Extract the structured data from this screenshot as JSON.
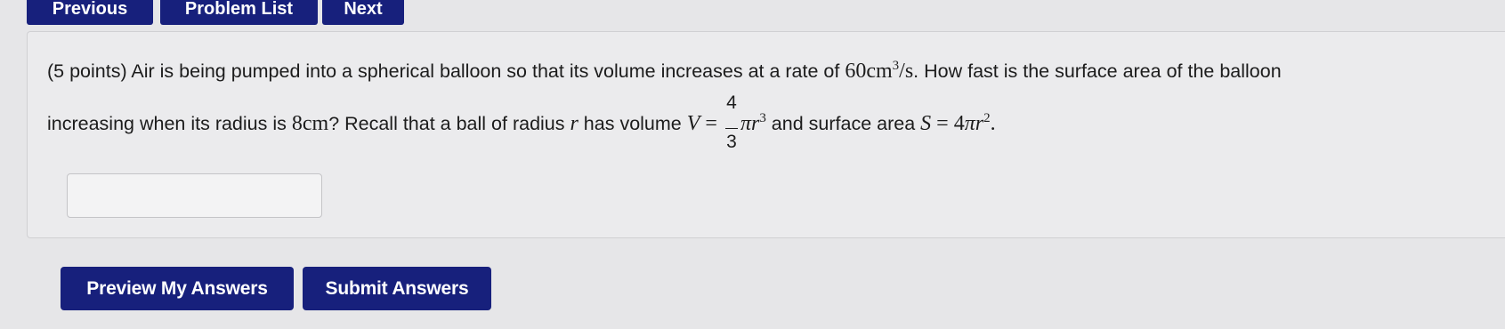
{
  "nav": {
    "previous_label": "Previous",
    "problem_list_label": "Problem List",
    "next_label": "Next"
  },
  "problem": {
    "line1_intro": "(5 points) Air is being pumped into a spherical balloon so that its volume increases at a rate of ",
    "rate_value": "60cm",
    "rate_exponent": "3",
    "rate_unit": "/s",
    "line1_rest": ". How fast is the surface area of the balloon",
    "line2_intro": "increasing when its radius is ",
    "radius_value": "8cm",
    "line2_mid": "? Recall that a ball of radius ",
    "radius_var": "r",
    "line2_has_volume": " has volume ",
    "volume_var": "V",
    "equals": " = ",
    "frac_num": "4",
    "frac_den": "3",
    "pi_r": "πr",
    "volume_exponent": "3",
    "and_surface": " and surface area ",
    "surface_var": "S",
    "surface_coef": "4",
    "surface_exponent": "2",
    "end_period": "."
  },
  "answer": {
    "value": "",
    "placeholder": ""
  },
  "actions": {
    "preview_label": "Preview My Answers",
    "submit_label": "Submit Answers"
  },
  "colors": {
    "button_bg": "#17207c",
    "button_text": "#ffffff",
    "page_bg": "#e6e6e8",
    "panel_bg": "#ebebed"
  }
}
